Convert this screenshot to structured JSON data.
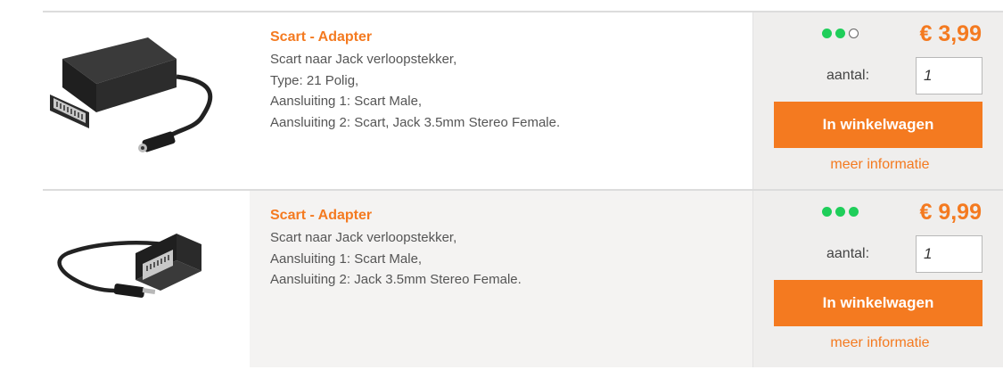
{
  "colors": {
    "accent": "#f47a20",
    "stock_green": "#1fce5a"
  },
  "products": [
    {
      "image": "scart-adapter-with-cable-icon",
      "title": "Scart - Adapter",
      "description": [
        "Scart naar Jack verloopstekker,",
        "Type: 21 Polig,",
        "Aansluiting 1: Scart Male,",
        "Aansluiting 2: Scart, Jack 3.5mm Stereo Female."
      ],
      "stock_level": 2,
      "stock_max": 3,
      "price": "€ 3,99",
      "qty_label": "aantal:",
      "qty_value": "1",
      "cart_button": "In winkelwagen",
      "more_info": "meer informatie"
    },
    {
      "image": "scart-to-jack-cable-icon",
      "title": "Scart - Adapter",
      "description": [
        "Scart naar Jack verloopstekker,",
        "Aansluiting 1: Scart Male,",
        "Aansluiting 2: Jack 3.5mm Stereo Female."
      ],
      "stock_level": 3,
      "stock_max": 3,
      "price": "€ 9,99",
      "qty_label": "aantal:",
      "qty_value": "1",
      "cart_button": "In winkelwagen",
      "more_info": "meer informatie"
    }
  ]
}
